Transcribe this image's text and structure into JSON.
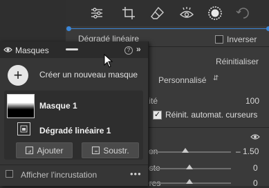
{
  "background_panel": {
    "mask_type": "Dégradé linéaire",
    "invert_label": "Inverser",
    "reset_label": "Réinitialiser",
    "preset_value": "Personnalisé",
    "amount_label": "tité",
    "amount_value": "100",
    "auto_reset_label": "Réinit. automat. curseurs",
    "auto_reset_checked": true,
    "sliders": [
      {
        "label": "tion",
        "value": "– 1.50",
        "level": 0.45
      },
      {
        "label": "uste",
        "value": "0",
        "level": 0.5
      },
      {
        "label": "ères",
        "value": "0",
        "level": 0.5
      }
    ]
  },
  "masks_panel": {
    "title": "Masques",
    "create_label": "Créer un nouveau masque",
    "masks": [
      {
        "name": "Masque 1",
        "components": [
          {
            "name": "Dégradé linéaire 1"
          }
        ]
      }
    ],
    "add_label": "Ajouter",
    "subtract_label": "Soustr.",
    "overlay_label": "Afficher l'incrustation",
    "more_label": "•••",
    "collapse_label": "»",
    "help_label": "?"
  },
  "colors": {
    "accent_blue": "#3b86d8",
    "panel_bg": "#363636"
  },
  "icons": [
    "sliders-icon",
    "crop-icon",
    "eraser-icon",
    "redeye-icon",
    "mask-circle-icon",
    "healing-icon",
    "eye-icon",
    "plus-icon",
    "mouse-cursor-icon"
  ]
}
